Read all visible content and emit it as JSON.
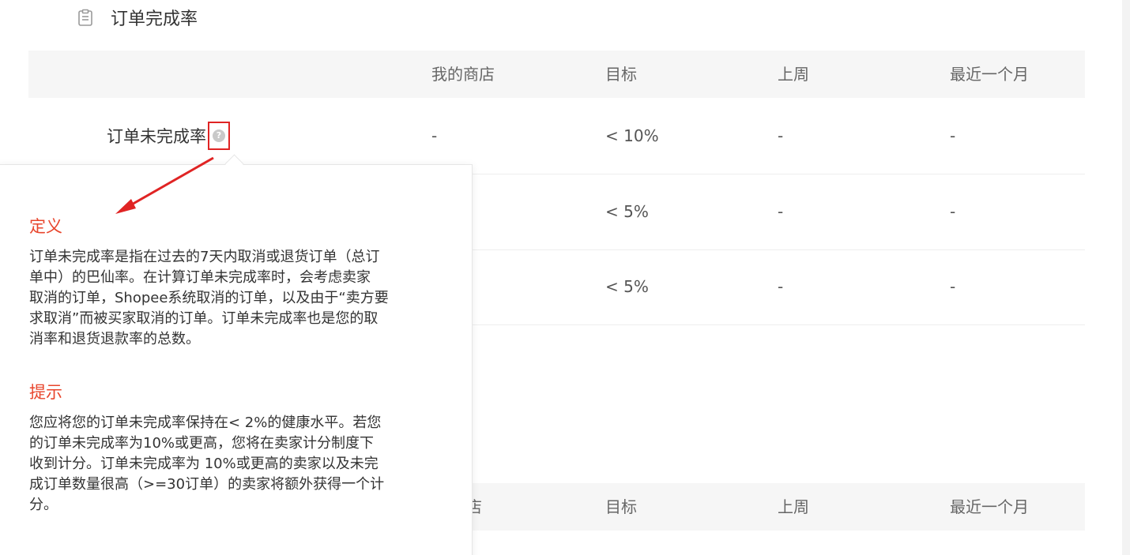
{
  "section": {
    "title": "订单完成率",
    "icon": "clipboard-icon"
  },
  "table": {
    "headers": [
      "我的商店",
      "目标",
      "上周",
      "最近一个月"
    ],
    "rows": [
      {
        "name": "订单未完成率",
        "my_store": "-",
        "target": "< 10%",
        "last_week": "-",
        "last_month": "-"
      },
      {
        "name": "",
        "my_store": "",
        "target": "< 5%",
        "last_week": "-",
        "last_month": "-"
      },
      {
        "name": "",
        "my_store": "",
        "target": "< 5%",
        "last_week": "-",
        "last_month": "-"
      }
    ]
  },
  "table2": {
    "headers": [
      "店",
      "目标",
      "上周",
      "最近一个月"
    ]
  },
  "help_icon": {
    "glyph": "?",
    "highlight_color": "#e02424"
  },
  "tooltip": {
    "definition_heading": "定义",
    "definition_lines": [
      "订单未完成率是指在过去的7天内取消或退货订单（总订",
      "单中）的巴仙率。在计算订单未完成率时，会考虑卖家",
      "取消的订单，Shopee系统取消的订单，以及由于“卖方要",
      "求取消”而被买家取消的订单。订单未完成率也是您的取",
      "消率和退货退款率的总数。"
    ],
    "tip_heading": "提示",
    "tip_lines": [
      "您应将您的订单未完成率保持在< 2%的健康水平。若您",
      "的订单未完成率为10%或更高，您将在卖家计分制度下",
      "收到计分。订单未完成率为 10%或更高的卖家以及未完",
      "成订单数量很高（>=30订单）的卖家将额外获得一个计",
      "分。"
    ],
    "heading_color": "#e8452c"
  },
  "annotation": {
    "arrow_color": "#e02424"
  }
}
